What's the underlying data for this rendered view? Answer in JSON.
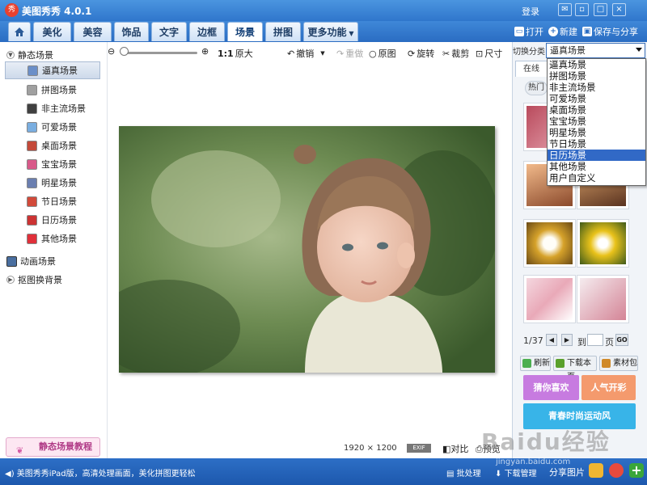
{
  "app": {
    "title": "美图秀秀 4.0.1",
    "logo_text": "秀",
    "login": "登录",
    "window_buttons": [
      "feedback-icon",
      "minimize-icon",
      "maximize-icon",
      "close-icon"
    ]
  },
  "menu": {
    "tabs": [
      {
        "label": "",
        "icon": "home-icon"
      },
      {
        "label": "美化"
      },
      {
        "label": "美容"
      },
      {
        "label": "饰品"
      },
      {
        "label": "文字"
      },
      {
        "label": "边框"
      },
      {
        "label": "场景",
        "active": true
      },
      {
        "label": "拼图"
      },
      {
        "label": "更多功能"
      }
    ],
    "open": "打开",
    "new": "新建",
    "save_share": "保存与分享"
  },
  "sidebar": {
    "group_static": "静态场景",
    "items": [
      {
        "label": "逼真场景",
        "selected": true,
        "color": "#6b8fc8"
      },
      {
        "label": "拼图场景",
        "color": "#a0a0a0"
      },
      {
        "label": "非主流场景",
        "color": "#404040"
      },
      {
        "label": "可爱场景",
        "color": "#7aaee0"
      },
      {
        "label": "桌面场景",
        "color": "#c44a3a"
      },
      {
        "label": "宝宝场景",
        "color": "#d85a8a"
      },
      {
        "label": "明星场景",
        "color": "#6b7fb0"
      },
      {
        "label": "节日场景",
        "color": "#d24a3a"
      },
      {
        "label": "日历场景",
        "color": "#cc3333"
      },
      {
        "label": "其他场景",
        "color": "#e0303a"
      }
    ],
    "group_anim": "动画场景",
    "group_bg": "抠图换背景",
    "tutorial": "静态场景教程"
  },
  "toolbar": {
    "zoom_ratio": "1:1",
    "original_size": "原大",
    "undo": "撤销",
    "redo": "重做",
    "original": "原图",
    "rotate": "旋转",
    "crop": "裁剪",
    "resize": "尺寸"
  },
  "canvas": {
    "width": "1920",
    "times": "×",
    "height": "1200",
    "exif": "EXIF",
    "compare": "对比",
    "preview": "预览"
  },
  "right": {
    "category_label": "切换分类",
    "selected_category": "逼真场景",
    "online_tab": "在线",
    "hot_btn": "热门",
    "dropdown_options": [
      "逼真场景",
      "拼图场景",
      "非主流场景",
      "可爱场景",
      "桌面场景",
      "宝宝场景",
      "明星场景",
      "节日场景",
      "日历场景",
      "其他场景",
      "用户自定义"
    ],
    "highlighted_option_index": 8,
    "pager": {
      "current": "1/37",
      "to": "到",
      "unit": "页",
      "go": "GO"
    },
    "refresh": "刷新",
    "download_page": "下载本页",
    "material_pack": "素材包",
    "banner_guess": "猜你喜欢",
    "banner_popular": "人气开彩",
    "banner_sport": "青春时尚运动风"
  },
  "statusbar": {
    "promo": "美图秀秀iPad版，高清处理画面，美化拼图更轻松",
    "batch": "批处理",
    "download_manage": "下载管理",
    "share": "分享图片"
  },
  "watermark": {
    "baidu": "Baidu经验",
    "url": "jingyan.baidu.com"
  }
}
